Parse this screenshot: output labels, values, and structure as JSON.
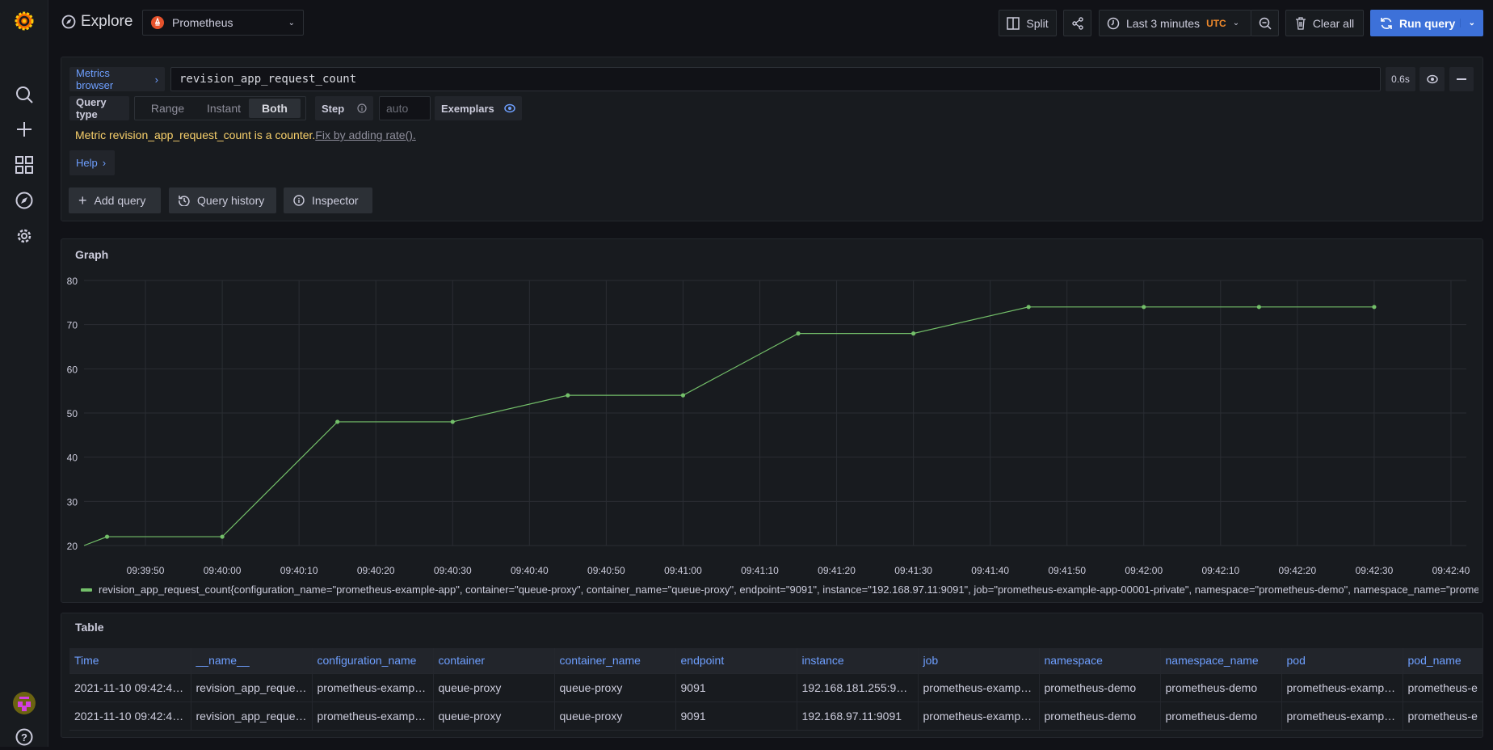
{
  "sidebar": {
    "items": [
      "grafana-logo",
      "search",
      "create",
      "dashboards",
      "explore",
      "configuration"
    ],
    "bottom": [
      "user-avatar",
      "help"
    ]
  },
  "header": {
    "title": "Explore",
    "datasource": "Prometheus",
    "split_label": "Split",
    "time_range": "Last 3 minutes",
    "timezone": "UTC",
    "clear_label": "Clear all",
    "run_label": "Run query"
  },
  "query": {
    "metrics_browser_label": "Metrics browser",
    "expression": "revision_app_request_count",
    "duration": "0.6s",
    "query_type_label": "Query type",
    "query_types": [
      "Range",
      "Instant",
      "Both"
    ],
    "selected_query_type": "Both",
    "step_label": "Step",
    "step_placeholder": "auto",
    "exemplars_label": "Exemplars",
    "warning_text": "Metric revision_app_request_count is a counter.",
    "warning_link": "Fix by adding rate().",
    "help_label": "Help",
    "add_query": "Add query",
    "query_history": "Query history",
    "inspector": "Inspector"
  },
  "graph": {
    "title": "Graph"
  },
  "chart_data": {
    "type": "line",
    "title": "",
    "xlabel": "",
    "ylabel": "",
    "x_range": [
      "09:39:42",
      "09:42:42"
    ],
    "ylim": [
      20,
      80
    ],
    "y_ticks": [
      20,
      30,
      40,
      50,
      60,
      70,
      80
    ],
    "x_ticks": [
      "09:39:50",
      "09:40:00",
      "09:40:10",
      "09:40:20",
      "09:40:30",
      "09:40:40",
      "09:40:50",
      "09:41:00",
      "09:41:10",
      "09:41:20",
      "09:41:30",
      "09:41:40",
      "09:41:50",
      "09:42:00",
      "09:42:10",
      "09:42:20",
      "09:42:30",
      "09:42:40"
    ],
    "grid": true,
    "legend": "bottom",
    "color": "#73bf69",
    "series": [
      {
        "name": "revision_app_request_count{configuration_name=\"prometheus-example-app\", container=\"queue-proxy\", container_name=\"queue-proxy\", endpoint=\"9091\", instance=\"192.168.97.11:9091\", job=\"prometheus-example-app-00001-private\", namespace=\"prometheus-demo\", namespace_name=\"prometheus-demo\", pod=\"p",
        "x": [
          "09:39:45",
          "09:40:00",
          "09:40:15",
          "09:40:30",
          "09:40:45",
          "09:41:00",
          "09:41:15",
          "09:41:30",
          "09:41:45",
          "09:42:00",
          "09:42:15",
          "09:42:30"
        ],
        "values": [
          22,
          22,
          48,
          48,
          54,
          54,
          68,
          68,
          74,
          74,
          74,
          74
        ],
        "line_start": {
          "x": "09:39:42",
          "value": 20
        }
      }
    ]
  },
  "table": {
    "title": "Table",
    "columns": [
      "Time",
      "__name__",
      "configuration_name",
      "container",
      "container_name",
      "endpoint",
      "instance",
      "job",
      "namespace",
      "namespace_name",
      "pod",
      "pod_name"
    ],
    "rows": [
      [
        "2021-11-10 09:42:4…",
        "revision_app_reque…",
        "prometheus-exampl…",
        "queue-proxy",
        "queue-proxy",
        "9091",
        "192.168.181.255:90…",
        "prometheus-exampl…",
        "prometheus-demo",
        "prometheus-demo",
        "prometheus-exampl…",
        "prometheus-e"
      ],
      [
        "2021-11-10 09:42:4…",
        "revision_app_reque…",
        "prometheus-exampl…",
        "queue-proxy",
        "queue-proxy",
        "9091",
        "192.168.97.11:9091",
        "prometheus-exampl…",
        "prometheus-demo",
        "prometheus-demo",
        "prometheus-exampl…",
        "prometheus-e"
      ]
    ]
  }
}
